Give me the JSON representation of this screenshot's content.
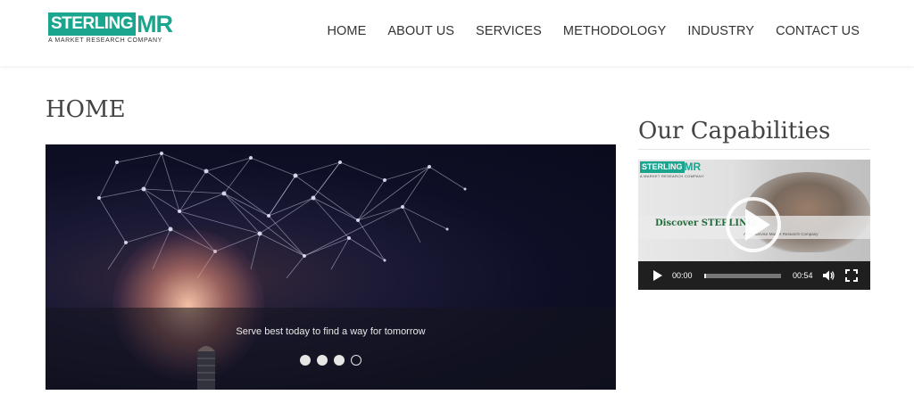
{
  "header": {
    "logo_text": "STERLING",
    "logo_suffix": "MR",
    "logo_tagline": "A MARKET RESEARCH COMPANY",
    "nav": [
      {
        "label": "HOME"
      },
      {
        "label": "ABOUT US"
      },
      {
        "label": "SERVICES"
      },
      {
        "label": "METHODOLOGY"
      },
      {
        "label": "INDUSTRY"
      },
      {
        "label": "CONTACT US"
      }
    ]
  },
  "page": {
    "title": "HOME"
  },
  "slider": {
    "caption": "Serve best today to find a way for tomorrow",
    "slides_total": 4,
    "active_slide": 4
  },
  "sidebar": {
    "title": "Our Capabilities",
    "video": {
      "logo_text": "STERLING",
      "logo_suffix": "MR",
      "logo_tagline": "A MARKET RESEARCH COMPANY",
      "overlay_text": "Discover STERLING",
      "overlay_subtext": "A Full Service Market Research Company",
      "current_time": "00:00",
      "duration": "00:54",
      "progress": 0.0
    }
  },
  "colors": {
    "brand": "#1aa58f",
    "text": "#333333",
    "video_controls_bg": "#1f1f1f"
  },
  "icons": {
    "play": "play-icon",
    "volume": "volume-icon",
    "fullscreen": "fullscreen-icon"
  }
}
